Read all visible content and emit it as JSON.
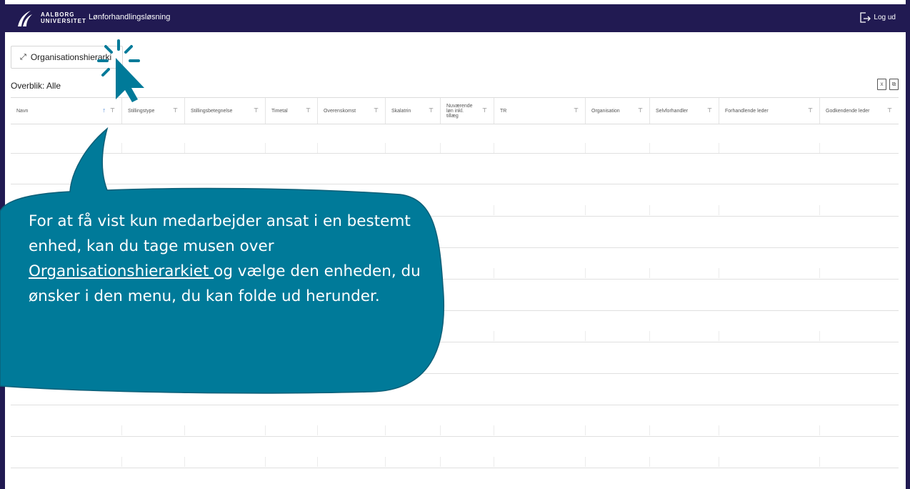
{
  "header": {
    "logo_line1": "AALBORG",
    "logo_line2": "UNIVERSITET",
    "app_title": "Lønforhandlingsløsning",
    "logout_label": "Log ud"
  },
  "toolbar": {
    "org_button_label": "Organisationshierarki",
    "overview_label": "Overblik: Alle"
  },
  "table": {
    "columns": [
      {
        "label": "Navn"
      },
      {
        "label": "Stillingstype"
      },
      {
        "label": "Stillingsbetegnelse"
      },
      {
        "label": "Timetal"
      },
      {
        "label": "Overenskomst"
      },
      {
        "label": "Skalatrin"
      },
      {
        "label": "Nuværende løn inkl. tillæg"
      },
      {
        "label": "TR"
      },
      {
        "label": "Organisation"
      },
      {
        "label": "Selvforhandler"
      },
      {
        "label": "Forhandlende leder"
      },
      {
        "label": "Godkendende leder"
      }
    ],
    "rows": []
  },
  "callout": {
    "text_before": "For at få vist kun medarbejder ansat i en bestemt enhed, kan du tage musen over ",
    "link_text": "Organisationshierarkiet ",
    "text_after": "og vælge den enheden, du ønsker i den menu, du kan folde ud herunder."
  },
  "colors": {
    "header_bg": "#211a52",
    "callout_bg": "#007a99",
    "sort_arrow": "#3a7bd5"
  },
  "icons": [
    "aau-logo-icon",
    "logout-icon",
    "expand-icon",
    "export-excel-icon",
    "copy-icon",
    "filter-icon",
    "sort-up-icon",
    "cursor-pointer-icon"
  ]
}
